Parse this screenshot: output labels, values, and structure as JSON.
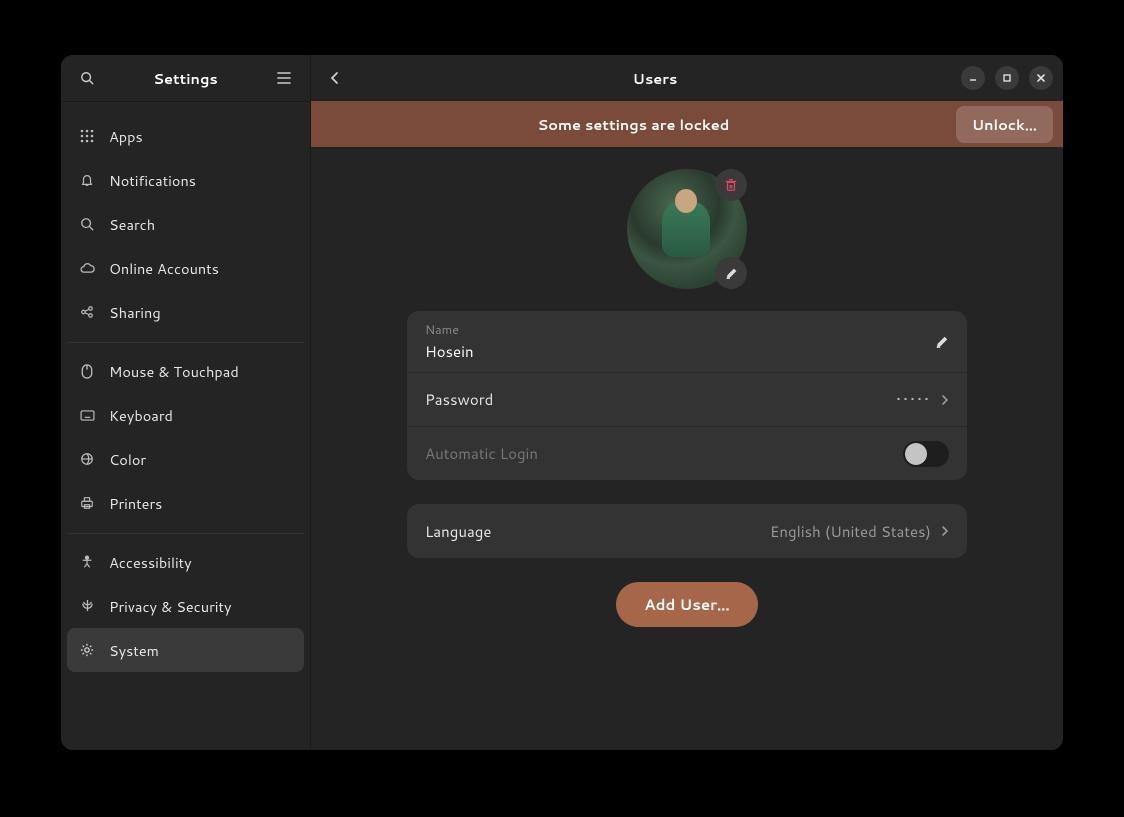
{
  "sidebar": {
    "title": "Settings",
    "groups": [
      {
        "items": [
          {
            "name": "apps",
            "label": "Apps",
            "icon": "grid-icon"
          },
          {
            "name": "notifications",
            "label": "Notifications",
            "icon": "bell-icon"
          },
          {
            "name": "search",
            "label": "Search",
            "icon": "search-icon"
          },
          {
            "name": "online-accounts",
            "label": "Online Accounts",
            "icon": "cloud-icon"
          },
          {
            "name": "sharing",
            "label": "Sharing",
            "icon": "share-icon"
          }
        ]
      },
      {
        "items": [
          {
            "name": "mouse",
            "label": "Mouse & Touchpad",
            "icon": "mouse-icon"
          },
          {
            "name": "keyboard",
            "label": "Keyboard",
            "icon": "keyboard-icon"
          },
          {
            "name": "color",
            "label": "Color",
            "icon": "color-icon"
          },
          {
            "name": "printers",
            "label": "Printers",
            "icon": "printer-icon"
          }
        ]
      },
      {
        "items": [
          {
            "name": "accessibility",
            "label": "Accessibility",
            "icon": "accessibility-icon"
          },
          {
            "name": "privacy",
            "label": "Privacy & Security",
            "icon": "privacy-icon"
          },
          {
            "name": "system",
            "label": "System",
            "icon": "gear-icon",
            "selected": true
          }
        ]
      }
    ]
  },
  "header": {
    "title": "Users"
  },
  "banner": {
    "text": "Some settings are locked",
    "button": "Unlock…"
  },
  "user": {
    "name_label": "Name",
    "name_value": "Hosein",
    "password_label": "Password",
    "password_mask": "•••••",
    "auto_login_label": "Automatic Login",
    "auto_login_on": false,
    "language_label": "Language",
    "language_value": "English (United States)"
  },
  "add_user_button": "Add User…"
}
